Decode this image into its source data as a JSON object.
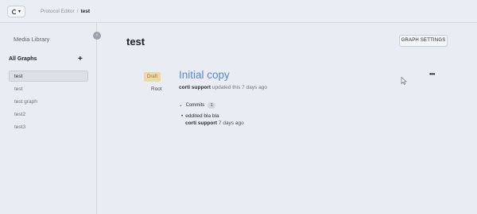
{
  "topbar": {
    "breadcrumb": [
      "Protocol Editor",
      "test"
    ],
    "separator": "/"
  },
  "sidebar": {
    "media_library": "Media Library",
    "section_title": "All Graphs",
    "add_icon": "+",
    "collapse_icon": "‹",
    "graphs": [
      {
        "label": "test",
        "active": true
      },
      {
        "label": "test"
      },
      {
        "label": "test graph"
      },
      {
        "label": "test2"
      },
      {
        "label": "test3"
      }
    ]
  },
  "main": {
    "title": "test",
    "settings_button": "GRAPH SETTINGS",
    "version": {
      "status_badge": "Draft",
      "branch_label": "Root",
      "title": "Initial copy",
      "updated_by": "corti support",
      "updated_text": "updated this 7 days ago",
      "more_icon": "•••"
    },
    "commits": {
      "label": "Commits",
      "count": "1",
      "items": [
        {
          "message": "eddited bla bla",
          "author": "corti support",
          "time": "7 days ago"
        }
      ]
    }
  },
  "colors": {
    "background": "#e9ecf3",
    "accent_link": "#5b86d8",
    "draft_badge_bg": "#ecd9a8"
  }
}
